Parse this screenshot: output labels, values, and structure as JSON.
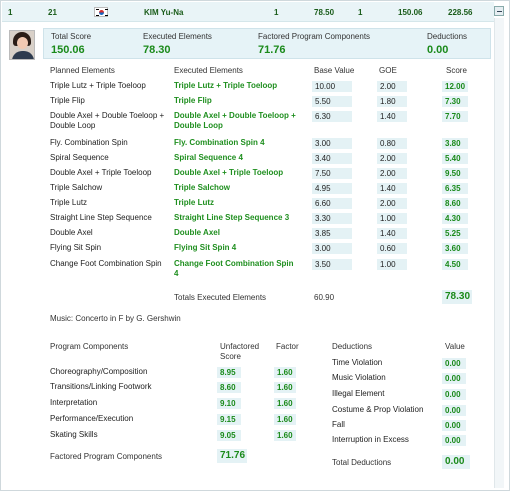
{
  "skater_row": {
    "rank": "1",
    "start_number": "21",
    "name": "KIM Yu-Na",
    "num1": "1",
    "score1": "78.50",
    "num2": "1",
    "score2": "150.06",
    "score3": "228.56"
  },
  "summary": {
    "total_score_label": "Total Score",
    "total_score": "150.06",
    "executed_label": "Executed Elements",
    "executed": "78.30",
    "factored_label": "Factored Program Components",
    "factored": "71.76",
    "deductions_label": "Deductions",
    "deductions": "0.00"
  },
  "elements_header": {
    "planned": "Planned Elements",
    "executed": "Executed Elements",
    "base": "Base Value",
    "goe": "GOE",
    "score": "Score"
  },
  "elements": [
    {
      "planned": "Triple Lutz + Triple Toeloop",
      "executed": "Triple Lutz + Triple Toeloop",
      "base": "10.00",
      "goe": "2.00",
      "score": "12.00"
    },
    {
      "planned": "Triple Flip",
      "executed": "Triple Flip",
      "base": "5.50",
      "goe": "1.80",
      "score": "7.30"
    },
    {
      "planned": "Double Axel + Double Toeloop + Double Loop",
      "executed": "Double Axel + Double Toeloop + Double Loop",
      "base": "6.30",
      "goe": "1.40",
      "score": "7.70"
    },
    {
      "planned": "Fly. Combination Spin",
      "executed": "Fly. Combination Spin 4",
      "base": "3.00",
      "goe": "0.80",
      "score": "3.80"
    },
    {
      "planned": "Spiral Sequence",
      "executed": "Spiral Sequence 4",
      "base": "3.40",
      "goe": "2.00",
      "score": "5.40"
    },
    {
      "planned": "Double Axel + Triple Toeloop",
      "executed": "Double Axel + Triple Toeloop",
      "base": "7.50",
      "goe": "2.00",
      "score": "9.50"
    },
    {
      "planned": "Triple Salchow",
      "executed": "Triple Salchow",
      "base": "4.95",
      "goe": "1.40",
      "score": "6.35"
    },
    {
      "planned": "Triple Lutz",
      "executed": "Triple Lutz",
      "base": "6.60",
      "goe": "2.00",
      "score": "8.60"
    },
    {
      "planned": "Straight Line Step Sequence",
      "executed": "Straight Line Step Sequence 3",
      "base": "3.30",
      "goe": "1.00",
      "score": "4.30"
    },
    {
      "planned": "Double Axel",
      "executed": "Double Axel",
      "base": "3.85",
      "goe": "1.40",
      "score": "5.25"
    },
    {
      "planned": "Flying Sit Spin",
      "executed": "Flying Sit Spin 4",
      "base": "3.00",
      "goe": "0.60",
      "score": "3.60"
    },
    {
      "planned": "Change Foot Combination Spin",
      "executed": "Change Foot Combination Spin 4",
      "base": "3.50",
      "goe": "1.00",
      "score": "4.50"
    }
  ],
  "totals": {
    "label": "Totals Executed Elements",
    "base": "60.90",
    "score": "78.30"
  },
  "music": "Music: Concerto in F by G. Gershwin",
  "components_header": {
    "name": "Program Components",
    "unfactored": "Unfactored Score",
    "factor": "Factor"
  },
  "components": [
    {
      "name": "Choreography/Composition",
      "score": "8.95",
      "factor": "1.60"
    },
    {
      "name": "Transitions/Linking Footwork",
      "score": "8.60",
      "factor": "1.60"
    },
    {
      "name": "Interpretation",
      "score": "9.10",
      "factor": "1.60"
    },
    {
      "name": "Performance/Execution",
      "score": "9.15",
      "factor": "1.60"
    },
    {
      "name": "Skating Skills",
      "score": "9.05",
      "factor": "1.60"
    }
  ],
  "factored_total": {
    "label": "Factored Program Components",
    "value": "71.76"
  },
  "deductions_header": {
    "name": "Deductions",
    "value": "Value"
  },
  "deductions": [
    {
      "name": "Time Violation",
      "value": "0.00"
    },
    {
      "name": "Music Violation",
      "value": "0.00"
    },
    {
      "name": "Illegal Element",
      "value": "0.00"
    },
    {
      "name": "Costume & Prop Violation",
      "value": "0.00"
    },
    {
      "name": "Fall",
      "value": "0.00"
    },
    {
      "name": "Interruption in Excess",
      "value": "0.00"
    }
  ],
  "total_deductions": {
    "label": "Total Deductions",
    "value": "0.00"
  },
  "colors": {
    "accent_green": "#1a8a1a",
    "panel_bg": "#e6f3f7"
  }
}
